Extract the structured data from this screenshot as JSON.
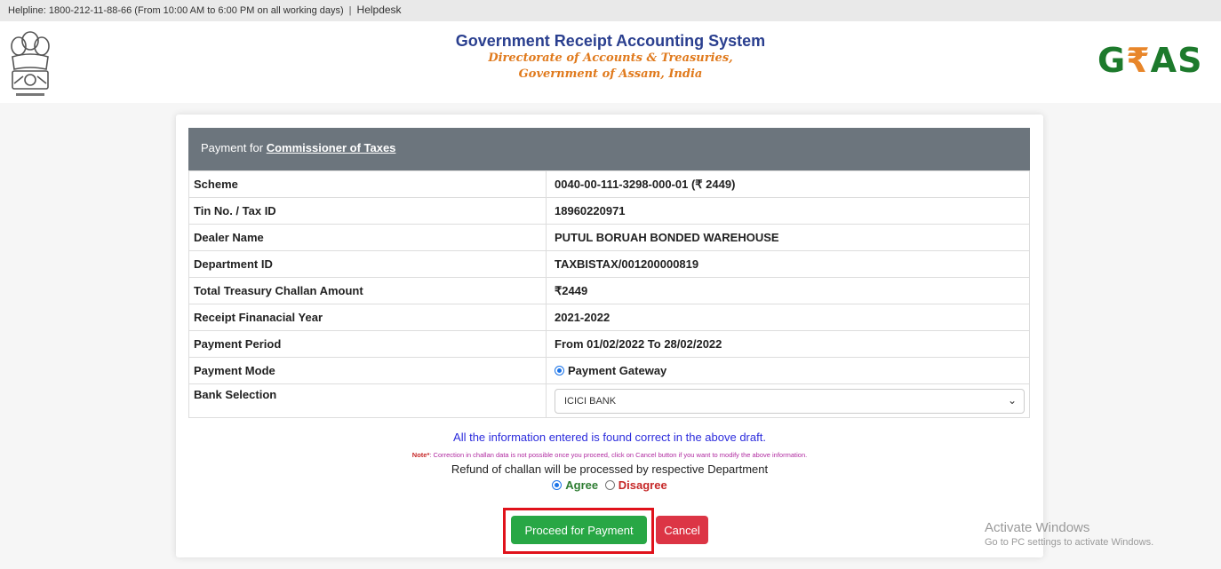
{
  "topbar": {
    "helpline": "Helpline: 1800-212-11-88-66 (From 10:00 AM to 6:00 PM on all working days)",
    "separator": "|",
    "helpdesk": "Helpdesk"
  },
  "header": {
    "title": "Government Receipt Accounting System",
    "subtitle1": "Directorate of Accounts & Treasuries,",
    "subtitle2": "Government of Assam, India",
    "logo_left": "G",
    "logo_rupee": "₹",
    "logo_right": "AS"
  },
  "panel": {
    "prefix": "Payment for",
    "department": "Commissioner of Taxes"
  },
  "rows": [
    {
      "label": "Scheme",
      "value": "0040-00-111-3298-000-01 (₹ 2449)"
    },
    {
      "label": "Tin No. / Tax ID",
      "value": "18960220971"
    },
    {
      "label": "Dealer Name",
      "value": "PUTUL BORUAH BONDED WAREHOUSE"
    },
    {
      "label": "Department ID",
      "value": "TAXBISTAX/001200000819"
    },
    {
      "label": "Total Treasury Challan Amount",
      "value": "₹2449"
    },
    {
      "label": "Receipt Finanacial Year",
      "value": "2021-2022"
    },
    {
      "label": "Payment Period",
      "value": "From 01/02/2022 To 28/02/2022"
    }
  ],
  "payment_mode": {
    "label": "Payment Mode",
    "option": "Payment Gateway"
  },
  "bank": {
    "label": "Bank Selection",
    "selected": "ICICI BANK"
  },
  "confirm": {
    "ok_text": "All the information entered is found correct in the above draft.",
    "note_label": "Note*",
    "note_text": ": Correction in challan data is not possible once you proceed, click on Cancel button if you want to modify the above information.",
    "refund": "Refund of challan will be processed by respective Department",
    "agree": "Agree",
    "disagree": "Disagree"
  },
  "buttons": {
    "proceed": "Proceed for Payment",
    "cancel": "Cancel"
  },
  "watermark": {
    "line1": "Activate Windows",
    "line2": "Go to PC settings to activate Windows."
  },
  "colors": {
    "panel": "#6c757d",
    "proceed": "#28a745",
    "cancel": "#dc3545",
    "title": "#2a3f8f",
    "subtitle": "#e07a1d",
    "logo": "#1d7a2c"
  }
}
